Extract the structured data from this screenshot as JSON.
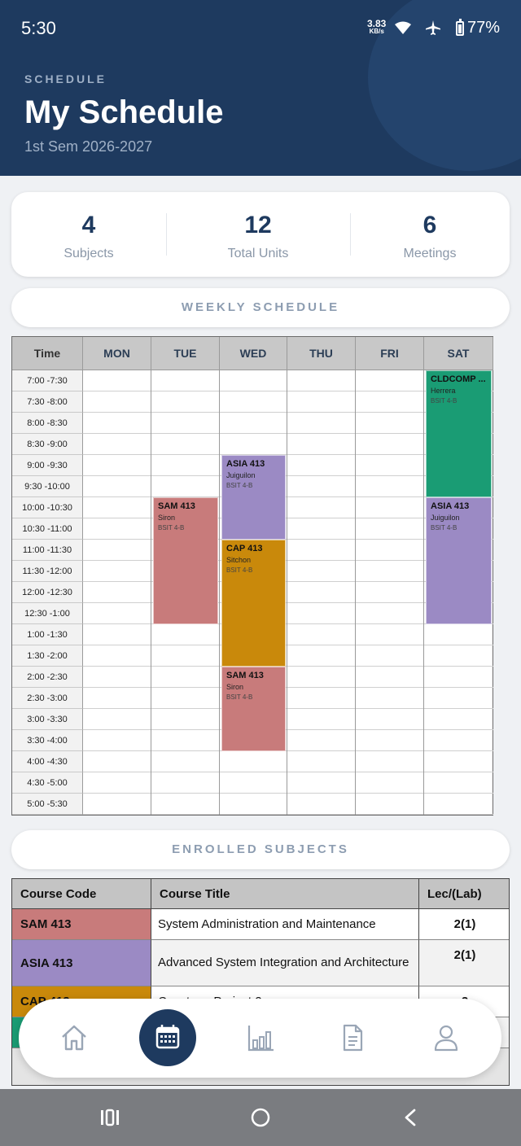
{
  "status_bar": {
    "time": "5:30",
    "net_speed": "3.83",
    "net_unit": "KB/s",
    "battery": "77%"
  },
  "header": {
    "eyebrow": "SCHEDULE",
    "title": "My Schedule",
    "subtitle": "1st Sem 2026-2027"
  },
  "stats": [
    {
      "value": "4",
      "label": "Subjects"
    },
    {
      "value": "12",
      "label": "Total Units"
    },
    {
      "value": "6",
      "label": "Meetings"
    }
  ],
  "weekly": {
    "heading": "WEEKLY SCHEDULE",
    "time_header": "Time",
    "days": [
      "MON",
      "TUE",
      "WED",
      "THU",
      "FRI",
      "SAT"
    ],
    "slots": [
      "7:00 -7:30",
      "7:30 -8:00",
      "8:00 -8:30",
      "8:30 -9:00",
      "9:00 -9:30",
      "9:30 -10:00",
      "10:00 -10:30",
      "10:30 -11:00",
      "11:00 -11:30",
      "11:30 -12:00",
      "12:00 -12:30",
      "12:30 -1:00",
      "1:00 -1:30",
      "1:30 -2:00",
      "2:00 -2:30",
      "2:30 -3:00",
      "3:00 -3:30",
      "3:30 -4:00",
      "4:00 -4:30",
      "4:30 -5:00",
      "5:00 -5:30"
    ],
    "events": [
      {
        "day": "SAT",
        "start": "7:00",
        "end": "10:00",
        "code": "CLDCOMP ...",
        "instructor": "Herrera",
        "section": "BSIT 4-B",
        "color": "#1a9c74"
      },
      {
        "day": "WED",
        "start": "9:00",
        "end": "11:00",
        "code": "ASIA 413",
        "instructor": "Juiguilon",
        "section": "BSIT 4-B",
        "color": "#9b8ac4"
      },
      {
        "day": "TUE",
        "start": "10:00",
        "end": "1:00",
        "code": "SAM 413",
        "instructor": "Siron",
        "section": "BSIT 4-B",
        "color": "#c87b7b"
      },
      {
        "day": "SAT",
        "start": "10:00",
        "end": "1:00",
        "code": "ASIA 413",
        "instructor": "Juiguilon",
        "section": "BSIT 4-B",
        "color": "#9b8ac4"
      },
      {
        "day": "WED",
        "start": "11:00",
        "end": "2:00",
        "code": "CAP 413",
        "instructor": "Sitchon",
        "section": "BSIT 4-B",
        "color": "#c9890b"
      },
      {
        "day": "WED",
        "start": "2:00",
        "end": "4:00",
        "code": "SAM 413",
        "instructor": "Siron",
        "section": "BSIT 4-B",
        "color": "#c87b7b"
      }
    ]
  },
  "enrolled": {
    "heading": "ENROLLED SUBJECTS",
    "headers": [
      "Course Code",
      "Course Title",
      "Lec/(Lab)"
    ],
    "rows": [
      {
        "code": "SAM 413",
        "title": "System Administration and Maintenance",
        "units": "2(1)",
        "color": "#c87b7b"
      },
      {
        "code": "ASIA 413",
        "title": "Advanced System Integration and Architecture",
        "units": "2(1)",
        "color": "#9b8ac4"
      },
      {
        "code": "CAP 413",
        "title": "Capstone Project 2",
        "units": "3",
        "color": "#c9890b"
      },
      {
        "code": "CLDCOMP",
        "title": "",
        "units": "",
        "color": "#1a9c74"
      }
    ]
  },
  "bottom_nav": [
    "home-icon",
    "calendar-icon",
    "chart-icon",
    "document-icon",
    "profile-icon"
  ],
  "colors": {
    "header": "#1e3a5f",
    "accent": "#1e3a5f"
  }
}
